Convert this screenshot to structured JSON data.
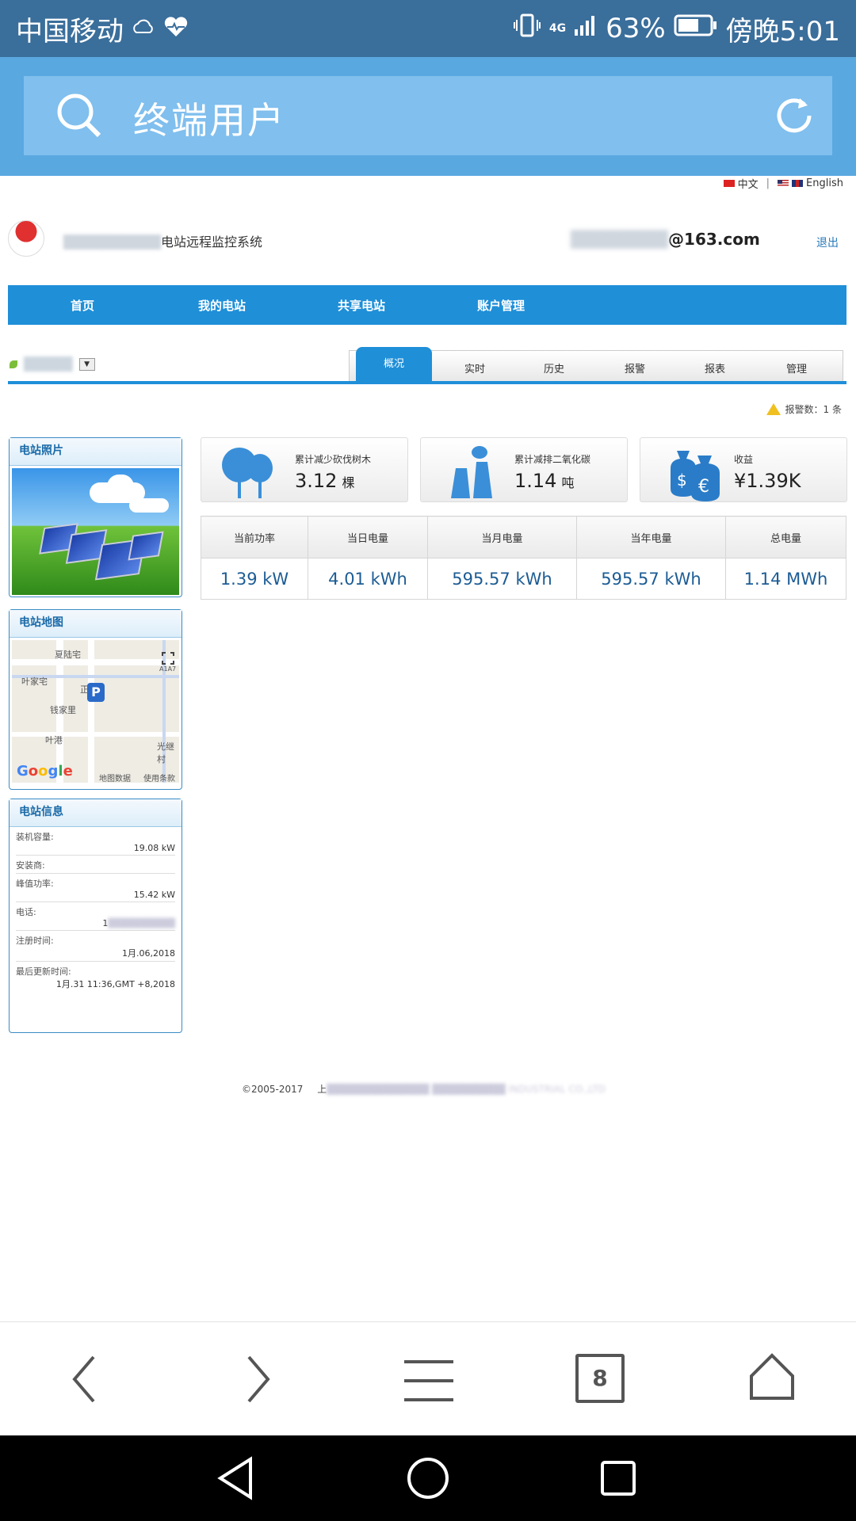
{
  "status_bar": {
    "carrier": "中国移动",
    "network": "4G",
    "battery": "63%",
    "time": "傍晚5:01"
  },
  "browser": {
    "search_text": "终端用户",
    "tab_count": "8"
  },
  "lang": {
    "chinese": "中文",
    "english": "English"
  },
  "header": {
    "system_title": "电站远程监控系统",
    "account_suffix": "@163.com",
    "logout": "退出"
  },
  "nav": [
    "首页",
    "我的电站",
    "共享电站",
    "账户管理"
  ],
  "tabs": {
    "active": "概况",
    "items": [
      "实时",
      "历史",
      "报警",
      "报表",
      "管理"
    ]
  },
  "alarm": {
    "label": "报警数：1 条"
  },
  "panels": {
    "photo_title": "电站照片",
    "map_title": "电站地图",
    "info_title": "电站信息",
    "map_labels": [
      "夏陆宅",
      "叶家宅",
      "正",
      "钱家里",
      "叶港",
      "光继村",
      "地图数据",
      "使用条款"
    ],
    "map_scale": "A1A7",
    "google": "Google",
    "info": [
      {
        "label": "装机容量:",
        "value": "19.08 kW"
      },
      {
        "label": "安装商:",
        "value": ""
      },
      {
        "label": "峰值功率:",
        "value": "15.42 kW"
      },
      {
        "label": "电话:",
        "value": "1"
      },
      {
        "label": "注册时间:",
        "value": "1月.06,2018"
      },
      {
        "label": "最后更新时间:",
        "value": "1月.31 11:36,GMT +8,2018"
      }
    ]
  },
  "cards": [
    {
      "label": "累计减少砍伐树木",
      "value": "3.12",
      "unit": "棵",
      "icon": "trees-icon"
    },
    {
      "label": "累计减排二氧化碳",
      "value": "1.14",
      "unit": "吨",
      "icon": "cooling-tower-icon"
    },
    {
      "label": "收益",
      "value": "¥1.39K",
      "unit": "",
      "icon": "money-bags-icon"
    }
  ],
  "stats": {
    "headers": [
      "当前功率",
      "当日电量",
      "当月电量",
      "当年电量",
      "总电量"
    ],
    "values": [
      "1.39 kW",
      "4.01 kWh",
      "595.57 kWh",
      "595.57 kWh",
      "1.14 MWh"
    ]
  },
  "footer": {
    "copyright": "©2005-2017",
    "company_hint": "上",
    "company_tail": "INDUSTRIAL CO.,LTD"
  },
  "colors": {
    "status_bar": "#3a6e9b",
    "browser_bar": "#5aa8e0",
    "nav": "#1f8fd8",
    "value_text": "#1c5c94"
  }
}
